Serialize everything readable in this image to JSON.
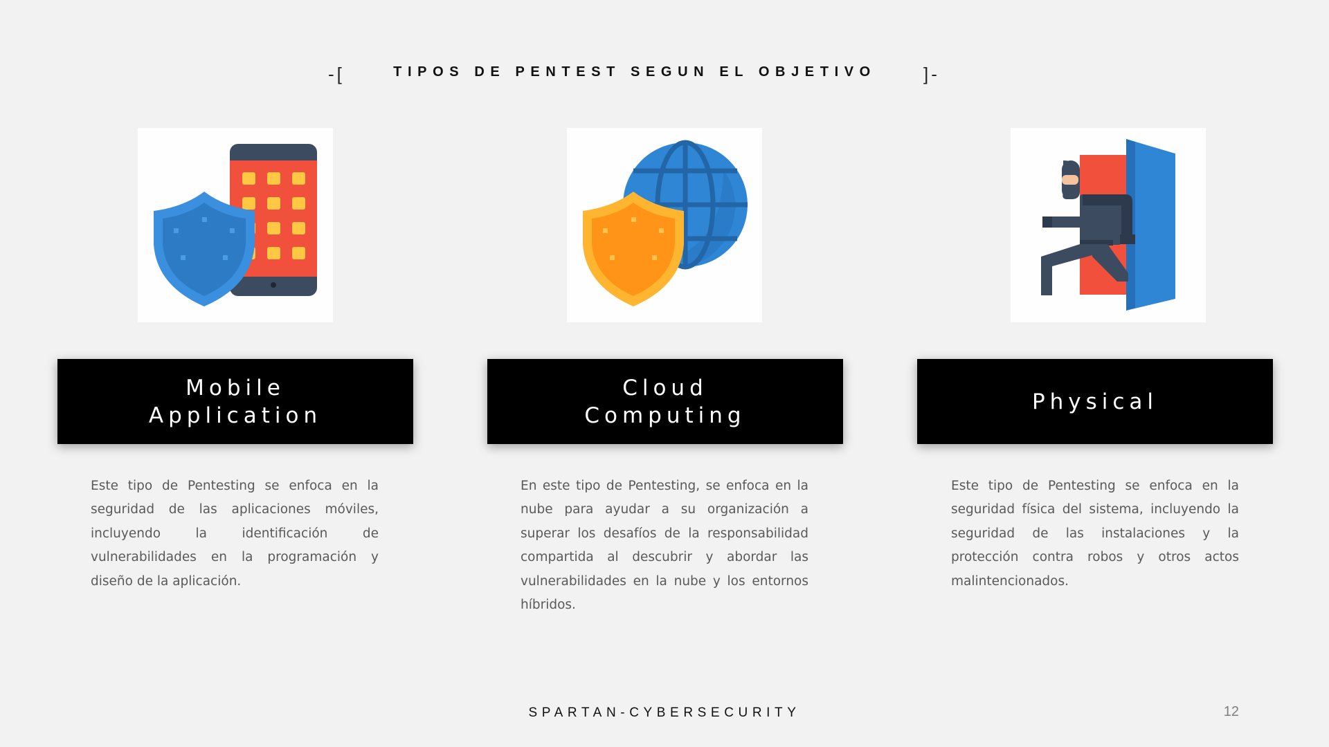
{
  "header": {
    "bracket_left": "-[",
    "title": "TIPOS DE PENTEST SEGUN EL OBJETIVO",
    "bracket_right": "]-"
  },
  "cards": [
    {
      "icon": "shield-phone-icon",
      "title_line1": "Mobile",
      "title_line2": "Application",
      "description": "Este tipo de Pentesting se enfoca en la seguridad de las aplicaciones móviles, incluyendo la identificación de vulnerabilidades en la programación y diseño de la aplicación."
    },
    {
      "icon": "shield-globe-icon",
      "title_line1": "Cloud",
      "title_line2": "Computing",
      "description": "En este tipo de Pentesting, se enfoca en la nube para ayudar a su organización a superar los desafíos de la responsabilidad compartida al descubrir y abordar las vulnerabilidades en la nube y los entornos híbridos."
    },
    {
      "icon": "intruder-door-icon",
      "title_line1": "Physical",
      "title_line2": "",
      "description": "Este tipo de Pentesting se enfoca en la seguridad física del sistema, incluyendo la seguridad de las instalaciones y la protección contra robos y otros actos malintencionados."
    }
  ],
  "footer": {
    "brand": "SPARTAN-CYBERSECURITY",
    "page_number": "12"
  },
  "colors": {
    "background": "#f2f2f2",
    "title_box": "#000000",
    "blue": "#2f86d4",
    "red": "#f0503c",
    "orange": "#ffb132",
    "dark_slate": "#3d4b60"
  }
}
